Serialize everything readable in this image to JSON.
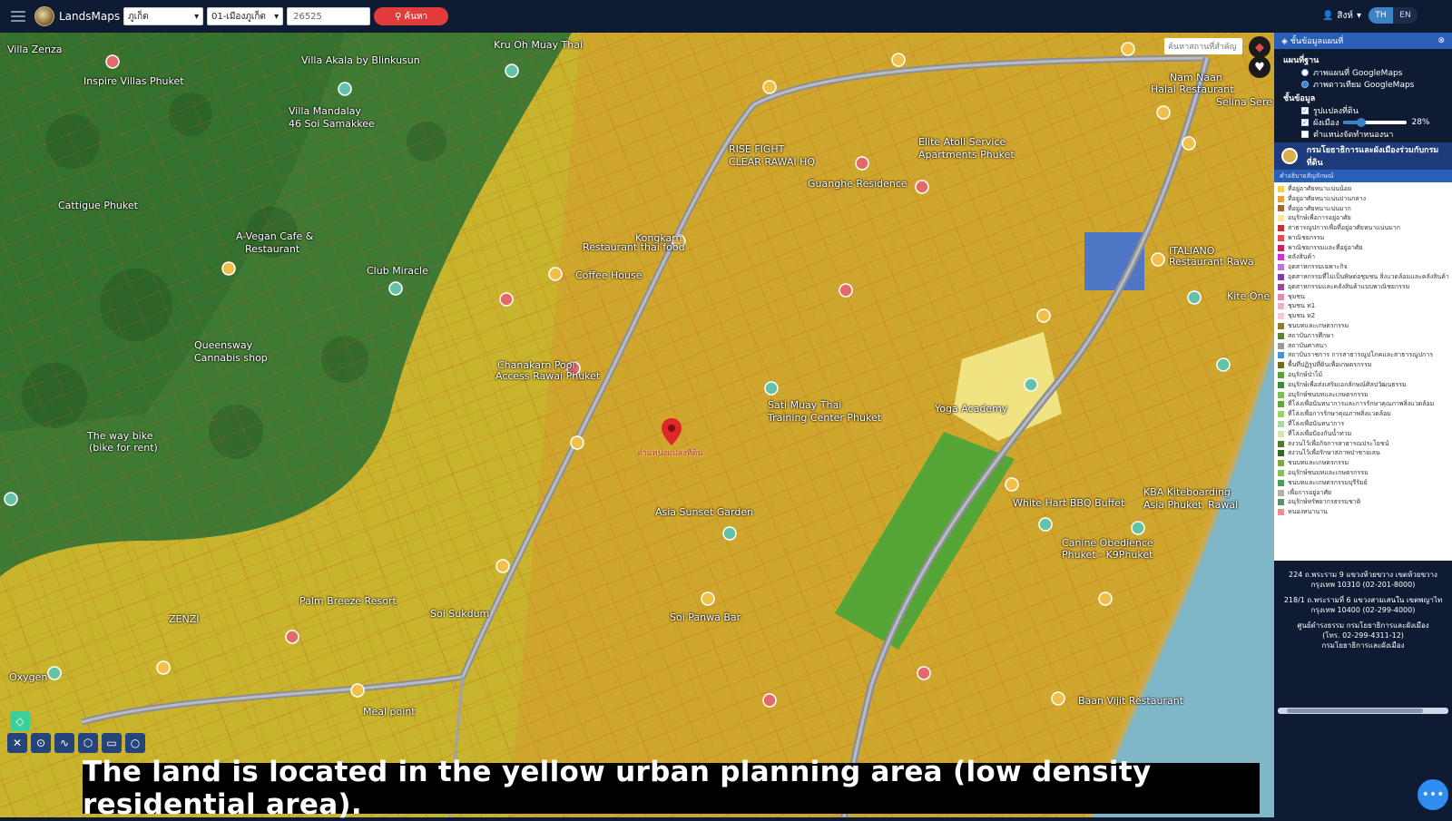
{
  "topbar": {
    "app_title": "LandsMaps",
    "province": "ภูเก็ต",
    "district": "01-เมืองภูเก็ต",
    "parcel_value": "26525",
    "search_label": "ค้นหา",
    "user_label": "สิงห์",
    "lang_th": "TH",
    "lang_en": "EN"
  },
  "map": {
    "search_placeholder": "ค้นหาสถานที่สำคัญ",
    "labels": {
      "kru_oh": "Kru Oh Muay Thai",
      "villa_zenza": "Villa Zenza",
      "villa_akala": "Villa Akala by Blinkusun",
      "inspire_villas": "Inspire Villas Phuket",
      "villa_mandalay": "Villa Mandalay",
      "soi_samakee": "46 Soi Samakkee",
      "rise_fight": "RISE FIGHT",
      "clear_rawai": "CLEAR RAWAI HQ",
      "elite_atoll": "Elite Atoll Service",
      "apartments": "Apartments Phuket",
      "nam_halal": "Nam Naan",
      "halal": "Halal Restaurant",
      "selina": "Selina Sere",
      "guanghe": "Guanghe Residence",
      "vegan_cafe": "A-Vegan Cafe &",
      "restaurant": "Restaurant",
      "kongkarn": "Kongkarn",
      "restaurant_thai": "Restaurant thai food",
      "coffee_house": "Coffee House",
      "club_miracle": "Club Miracle",
      "cattigue": "Cattigue Phuket",
      "italiano": "ITALIANO",
      "restaurant_rawai": "Restaurant Rawa",
      "kite_one": "Kite One",
      "queensway": "Queensway",
      "cannabis": "Cannabis shop",
      "chanakarn": "Chanakarn Pool",
      "access_rawai": "Access Rawai Phuket",
      "sati": "Sati Muay Thai",
      "training": "Training Center Phuket",
      "yoga": "Yoga Academy",
      "the_way": "The way bike",
      "bike_rent": "(bike for rent)",
      "asia_sunset": "Asia Sunset Garden",
      "white_hart": "White Hart BBQ Buffet",
      "kba": "KBA Kiteboarding",
      "asia_phuket": "Asia Phuket, Rawai",
      "canine": "Canine Obedience",
      "k9": "Phuket - K9Phuket",
      "palm_breeze": "Palm Breeze Resort",
      "baan_vijit": "Baan Vijit Restaurant",
      "oxygen": "Oxygen",
      "zenzi": "ZENZI",
      "meal_point": "Meal point",
      "soi_sukdum": "Soi Sukdum",
      "soi_panwa": "Soi Panwa Bar"
    },
    "pin_label": "ตำแหน่งแปลงที่ดิน"
  },
  "subtitle": "The land is located in the yellow urban planning area (low density residential area).",
  "panel": {
    "header": "ชั้นข้อมูลแผนที่",
    "basemap_title": "แผนที่ฐาน",
    "basemap_opt1": "ภาพแผนที่ GoogleMaps",
    "basemap_opt2": "ภาพดาวเทียม GoogleMaps",
    "layers_title": "ชั้นข้อมูล",
    "layer_parcel": "รูปแปลงที่ดิน",
    "layer_cityplan": "ผังเมือง",
    "layer_cityplan_opacity": "28%",
    "opacity_fraction": 0.28,
    "layer_office": "ตำแหน่งจัดทำหนองนา",
    "dept_name": "กรมโยธาธิการและผังเมืองร่วมกับกรมที่ดิน",
    "legend_title": "คำอธิบายสัญลักษณ์",
    "legend": [
      {
        "color": "#f2d34b",
        "label": "ที่อยู่อาศัยหนาแน่นน้อย"
      },
      {
        "color": "#e8a23a",
        "label": "ที่อยู่อาศัยหนาแน่นปานกลาง"
      },
      {
        "color": "#9c6b2e",
        "label": "ที่อยู่อาศัยหนาแน่นมาก"
      },
      {
        "color": "#f7e99b",
        "label": "อนุรักษ์เพื่อการอยู่อาศัย"
      },
      {
        "color": "#c93030",
        "label": "สาธารณูปการเพื่อที่อยู่อาศัยหนาแน่นมาก"
      },
      {
        "color": "#e44d4d",
        "label": "พาณิชยกรรม"
      },
      {
        "color": "#d01f5a",
        "label": "พาณิชยกรรมและที่อยู่อาศัย"
      },
      {
        "color": "#cc33cc",
        "label": "คลังสินค้า"
      },
      {
        "color": "#b575d1",
        "label": "อุตสาหกรรมเฉพาะกิจ"
      },
      {
        "color": "#7d3fa8",
        "label": "อุตสาหกรรมที่ไม่เป็นพิษต่อชุมชน สิ่งแวดล้อมและคลังสินค้า"
      },
      {
        "color": "#9a4b9c",
        "label": "อุตสาหกรรมและคลังสินค้าแบบพาณิชยกรรม"
      },
      {
        "color": "#e08bb4",
        "label": "ชุมชน"
      },
      {
        "color": "#eeb0c8",
        "label": "ชุมชน ท1"
      },
      {
        "color": "#f4c7d7",
        "label": "ชุมชน ท2"
      },
      {
        "color": "#8a7c35",
        "label": "ชนบทและเกษตรกรรม"
      },
      {
        "color": "#5d7f2e",
        "label": "สถาบันการศึกษา"
      },
      {
        "color": "#9a9a9a",
        "label": "สถาบันศาสนา"
      },
      {
        "color": "#4a90d9",
        "label": "สถาบันราชการ การสาธารณูปโภคและสาธารณูปการ"
      },
      {
        "color": "#6e6e1c",
        "label": "พื้นที่ปฏิรูปที่ดินเพื่อเกษตรกรรม"
      },
      {
        "color": "#5aa33c",
        "label": "อนุรักษ์ป่าไม้"
      },
      {
        "color": "#3f8a3a",
        "label": "อนุรักษ์เพื่อส่งเสริมเอกลักษณ์ศิลปวัฒนธรรม"
      },
      {
        "color": "#7ac050",
        "label": "อนุรักษ์ชนบทและเกษตรกรรม"
      },
      {
        "color": "#61a83d",
        "label": "ที่โล่งเพื่อนันทนาการและการรักษาคุณภาพสิ่งแวดล้อม"
      },
      {
        "color": "#9cd26a",
        "label": "ที่โล่งเพื่อการรักษาคุณภาพสิ่งแวดล้อม"
      },
      {
        "color": "#a9d8a0",
        "label": "ที่โล่งเพื่อนันทนาการ"
      },
      {
        "color": "#cfe7b5",
        "label": "ที่โล่งเพื่อป้องกันน้ำท่วม"
      },
      {
        "color": "#4e7a22",
        "label": "สงวนไว้เพื่อกิจการสาธารณประโยชน์"
      },
      {
        "color": "#2f6b1d",
        "label": "สงวนไว้เพื่อรักษาสภาพป่าชายเลน"
      },
      {
        "color": "#7fa845",
        "label": "ชนบทและเกษตรกรรม"
      },
      {
        "color": "#88c060",
        "label": "อนุรักษ์ชนบทและเกษตรกรรม"
      },
      {
        "color": "#4c9d5a",
        "label": "ชนบทและเกษตรกรรมบุรีรัมย์"
      },
      {
        "color": "#b0b0b0",
        "label": "เพื่อการอยู่อาศัย"
      },
      {
        "color": "#5e8f6e",
        "label": "อนุรักษ์ทรัพยากรธรรมชาติ"
      },
      {
        "color": "#e89090",
        "label": "หนองหนานาน"
      }
    ],
    "footer": {
      "addr1": "224 ถ.พระราม 9 แขวงห้วยขวาง เขตห้วยขวาง กรุงเทพ 10310 (02-201-8000)",
      "addr2": "218/1 ถ.พระรามที่ 6 แขวงสามเสนใน เขตพญาไท กรุงเทพ 10400 (02-299-4000)",
      "addr3": "ศูนย์ดำรงธรรม กรมโยธาธิการและผังเมือง",
      "addr4": "(โทร. 02-299-4311-12)",
      "addr5": "กรมโยธาธิการและผังเมือง"
    }
  },
  "colors": {
    "topbar": "#0f1b33",
    "accent_blue": "#2a5fb8",
    "search_red": "#e23b3b",
    "zone_yellow": "#e6d53a",
    "zone_orange": "#d98f2a",
    "zone_green": "#3a8a2e"
  },
  "icons": {
    "menu": "hamburger-icon",
    "search": "magnifier-icon",
    "user": "person-icon",
    "layers": "layers-icon",
    "favorite": "heart-icon",
    "pin": "map-pin-icon",
    "chat": "chat-bubble-icon"
  }
}
